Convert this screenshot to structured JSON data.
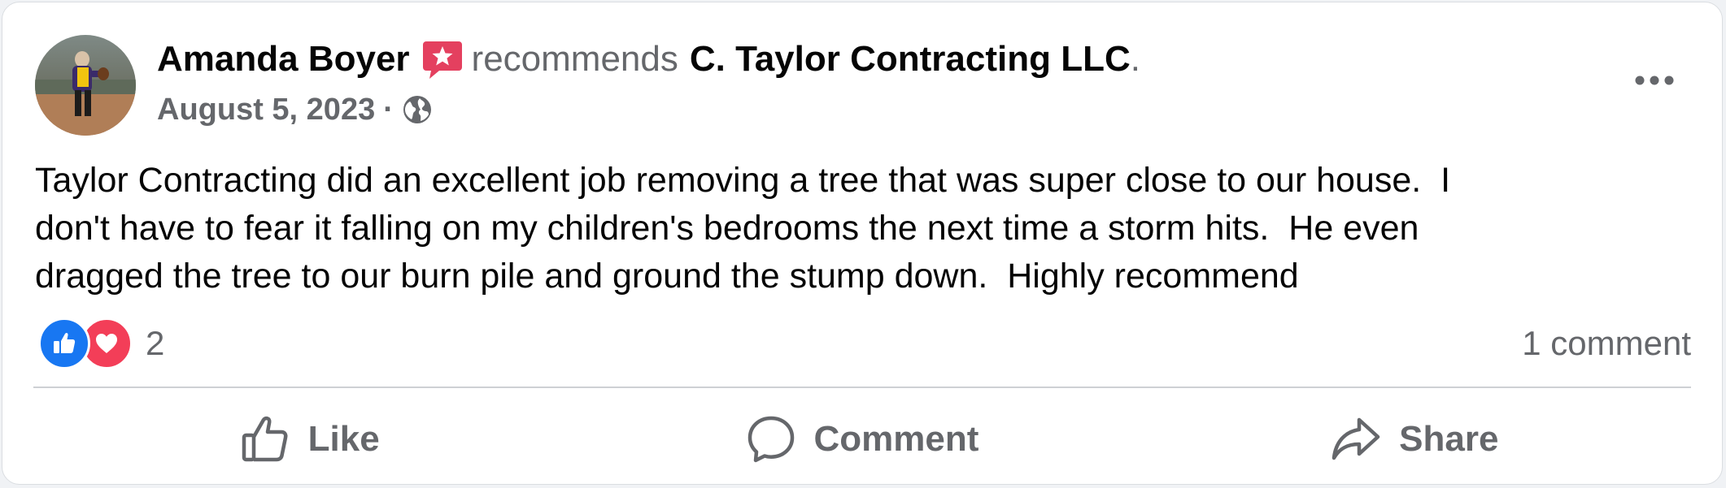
{
  "post": {
    "author_name": "Amanda Boyer",
    "verb": "recommends",
    "page_name": "C. Taylor Contracting LLC",
    "period": ".",
    "date": "August 5, 2023",
    "meta_separator": "·",
    "audience_icon": "globe-icon",
    "badge_icon": "recommendation-star-icon",
    "more_icon": "more-horizontal-icon",
    "body": "Taylor Contracting did an excellent job removing a tree that was super close to our house.  I\ndon't have to fear it falling on my children's bedrooms the next time a storm hits.  He even\ndragged the tree to our burn pile and ground the stump down.  Highly recommend"
  },
  "engagement": {
    "reaction_icons": [
      "like-reaction-icon",
      "love-reaction-icon"
    ],
    "reaction_count": "2",
    "comment_count": "1 comment"
  },
  "actions": {
    "like_label": "Like",
    "comment_label": "Comment",
    "share_label": "Share"
  },
  "colors": {
    "primary_text": "#050505",
    "secondary_text": "#65676b",
    "like_blue": "#1877f2",
    "love_red": "#f33e58",
    "badge_pink": "#e4405f",
    "divider": "#ced0d4"
  }
}
